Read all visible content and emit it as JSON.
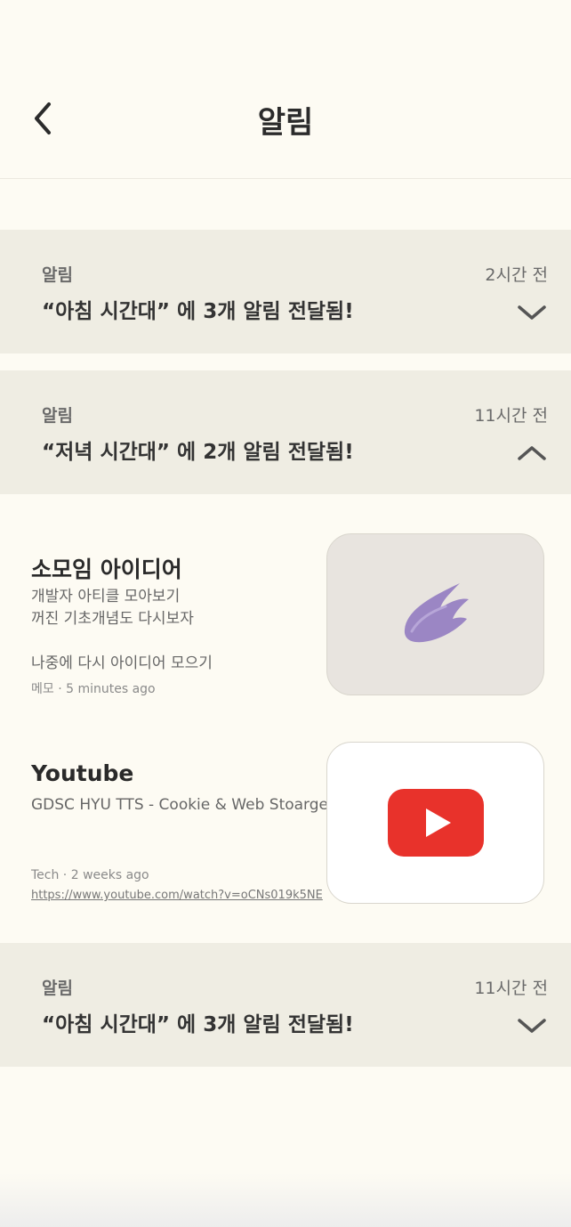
{
  "header": {
    "title": "알림",
    "back_icon": "chevron-left-icon"
  },
  "groups": [
    {
      "label": "알림",
      "time": "2시간 전",
      "message": "“아침 시간대” 에 3개 알림 전달됨!",
      "state": "collapsed",
      "toggle_icon": "chevron-down-icon"
    },
    {
      "label": "알림",
      "time": "11시간 전",
      "message": "“저녁 시간대” 에 2개 알림 전달됨!",
      "state": "expanded",
      "toggle_icon": "chevron-up-icon"
    },
    {
      "label": "알림",
      "time": "11시간 전",
      "message": "“아침 시간대” 에 3개 알림 전달됨!",
      "state": "collapsed",
      "toggle_icon": "chevron-down-icon"
    }
  ],
  "cards": [
    {
      "title": "소모임 아이디어",
      "description": "개발자 아티클 모아보기\n꺼진 기초개념도 다시보자\n\n나중에 다시 아이디어 모으기",
      "meta": "메모 · 5 minutes ago",
      "thumbnail_icon": "wing-icon",
      "thumbnail_bg": "#e8e4df"
    },
    {
      "title": "Youtube",
      "description": "GDSC HYU TTS - Cookie & Web Stoarge",
      "meta": "Tech · 2 weeks ago",
      "link": "https://www.youtube.com/watch?v=oCNs019k5NE",
      "thumbnail_icon": "youtube-icon",
      "thumbnail_bg": "#ffffff"
    }
  ],
  "colors": {
    "background": "#fdfbf3",
    "group_bg": "#efede3",
    "youtube_red": "#e8322b",
    "wing_purple": "#9b86c4"
  }
}
